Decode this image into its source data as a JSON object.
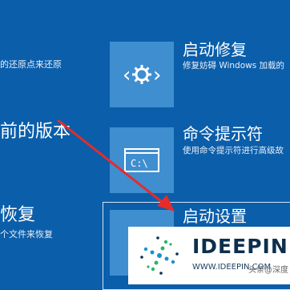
{
  "left_options": [
    {
      "desc": "的还原点来还原"
    },
    {
      "title": "前的版本"
    },
    {
      "title": "恢复",
      "desc": "个文件来恢复"
    }
  ],
  "options": [
    {
      "title": "启动修复",
      "desc": "修复妨碍 Windows 加载的",
      "icon": "gear-diagnostic-icon"
    },
    {
      "title": "命令提示符",
      "desc": "使用命令提示符进行高级故",
      "icon": "command-prompt-icon",
      "icon_text": "C:\\"
    },
    {
      "title": "启动设置",
      "icon": "startup-settings-icon"
    }
  ],
  "watermark": {
    "text": "IDEEPIN",
    "url": "WWW.IDEEPIN.COM",
    "sub": "头条@深度"
  },
  "colors": {
    "background": "#0b5eaa",
    "tile": "#3f8ed0",
    "arrow": "#e62b2b"
  }
}
